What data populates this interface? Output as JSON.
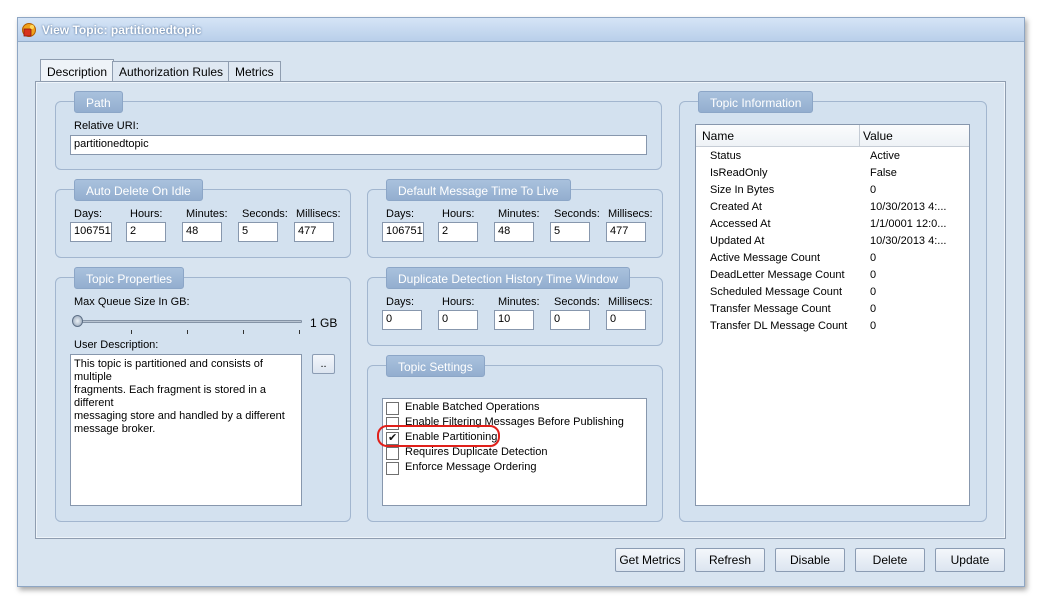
{
  "window": {
    "title": "View Topic: partitionedtopic"
  },
  "tabs": [
    {
      "label": "Description"
    },
    {
      "label": "Authorization Rules"
    },
    {
      "label": "Metrics"
    }
  ],
  "path": {
    "legend": "Path",
    "relative_uri_label": "Relative URI:",
    "relative_uri_value": "partitionedtopic"
  },
  "time_labels": {
    "days": "Days:",
    "hours": "Hours:",
    "minutes": "Minutes:",
    "seconds": "Seconds:",
    "millisecs": "Millisecs:"
  },
  "auto_delete": {
    "legend": "Auto Delete On Idle",
    "values": {
      "days": "106751",
      "hours": "2",
      "minutes": "48",
      "seconds": "5",
      "millisecs": "477"
    }
  },
  "default_ttl": {
    "legend": "Default Message Time To Live",
    "values": {
      "days": "106751",
      "hours": "2",
      "minutes": "48",
      "seconds": "5",
      "millisecs": "477"
    }
  },
  "dup_detection": {
    "legend": "Duplicate Detection History Time Window",
    "values": {
      "days": "0",
      "hours": "0",
      "minutes": "10",
      "seconds": "0",
      "millisecs": "0"
    }
  },
  "topic_properties": {
    "legend": "Topic Properties",
    "max_queue_label": "Max Queue Size In GB:",
    "max_queue_value_label": "1 GB",
    "slider_level": 0,
    "user_description_label": "User Description:",
    "user_description": "This topic is partitioned and consists of multiple\nfragments. Each fragment is stored in a different\nmessaging store and handled by a different\nmessage broker.",
    "ellipsis_button": ".."
  },
  "topic_settings": {
    "legend": "Topic Settings",
    "options": [
      {
        "label": "Enable Batched Operations",
        "checked": false
      },
      {
        "label": "Enable Filtering Messages Before Publishing",
        "checked": false
      },
      {
        "label": "Enable Partitioning",
        "checked": true
      },
      {
        "label": "Requires Duplicate Detection",
        "checked": false
      },
      {
        "label": "Enforce Message Ordering",
        "checked": false
      }
    ],
    "highlight_color": "#e0201a"
  },
  "topic_info": {
    "legend": "Topic Information",
    "columns": [
      "Name",
      "Value"
    ],
    "rows": [
      {
        "name": "Status",
        "value": "Active"
      },
      {
        "name": "IsReadOnly",
        "value": "False"
      },
      {
        "name": "Size In Bytes",
        "value": "0"
      },
      {
        "name": "Created At",
        "value": "10/30/2013 4:..."
      },
      {
        "name": "Accessed At",
        "value": "1/1/0001 12:0..."
      },
      {
        "name": "Updated At",
        "value": "10/30/2013 4:..."
      },
      {
        "name": "Active Message Count",
        "value": "0"
      },
      {
        "name": "DeadLetter Message Count",
        "value": "0"
      },
      {
        "name": "Scheduled Message Count",
        "value": "0"
      },
      {
        "name": "Transfer Message Count",
        "value": "0"
      },
      {
        "name": "Transfer DL Message Count",
        "value": "0"
      }
    ]
  },
  "buttons": {
    "get_metrics": "Get Metrics",
    "refresh": "Refresh",
    "disable": "Disable",
    "delete": "Delete",
    "update": "Update"
  },
  "colors": {
    "window_bg": "#d8e4f0",
    "legend_bg": "#9db7d7",
    "accent": "#3d5f8a"
  },
  "icons": {
    "app": "topic-icon"
  }
}
